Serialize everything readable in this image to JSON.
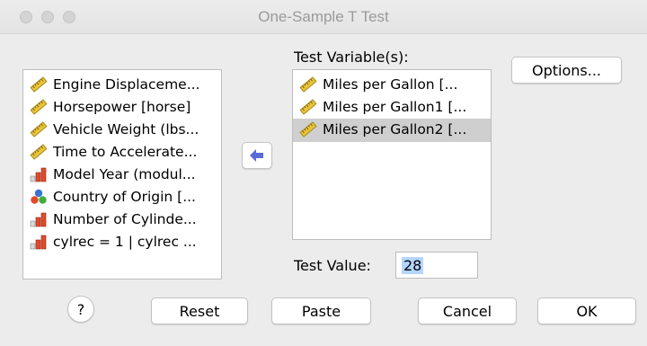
{
  "window": {
    "title": "One-Sample T Test"
  },
  "source_list": {
    "items": [
      {
        "label": "Engine Displaceme...",
        "icon": "scale-ruler-icon"
      },
      {
        "label": "Horsepower [horse]",
        "icon": "scale-ruler-icon"
      },
      {
        "label": "Vehicle Weight (lbs...",
        "icon": "scale-ruler-icon"
      },
      {
        "label": "Time to Accelerate...",
        "icon": "scale-ruler-icon"
      },
      {
        "label": "Model Year (modul...",
        "icon": "ordinal-bar-icon"
      },
      {
        "label": "Country of Origin [...",
        "icon": "nominal-circles-icon"
      },
      {
        "label": "Number of Cylinde...",
        "icon": "ordinal-bar-icon"
      },
      {
        "label": "cylrec = 1 | cylrec ...",
        "icon": "ordinal-bar-icon"
      }
    ]
  },
  "test_variables": {
    "label": "Test Variable(s):",
    "items": [
      {
        "label": "Miles per Gallon [...",
        "icon": "scale-ruler-icon",
        "selected": false
      },
      {
        "label": "Miles per Gallon1 [...",
        "icon": "scale-ruler-icon",
        "selected": false
      },
      {
        "label": "Miles per Gallon2 [...",
        "icon": "scale-ruler-icon",
        "selected": true
      }
    ]
  },
  "move_button": {
    "icon": "arrow-left-icon",
    "color": "#5b6bd6"
  },
  "test_value": {
    "label": "Test Value:",
    "value": "28"
  },
  "buttons": {
    "options": "Options...",
    "help": "?",
    "reset": "Reset",
    "paste": "Paste",
    "cancel": "Cancel",
    "ok": "OK"
  }
}
